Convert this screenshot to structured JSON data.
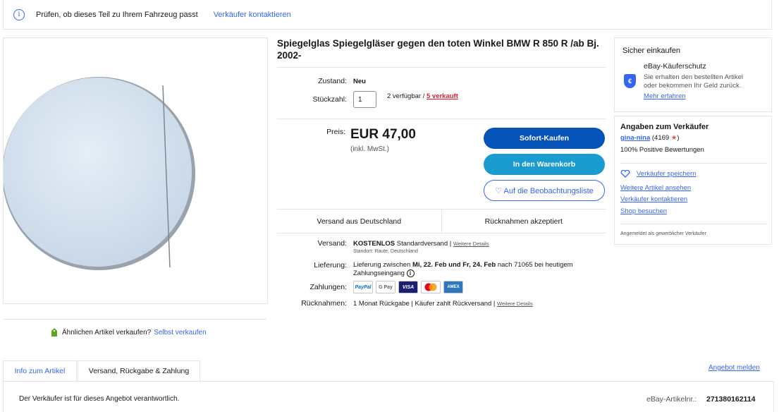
{
  "banner": {
    "text": "Prüfen, ob dieses Teil zu Ihrem Fahrzeug passt",
    "link": "Verkäufer kontaktieren"
  },
  "product": {
    "title": "Spiegelglas Spiegelgläser gegen den toten Winkel BMW R 850 R /ab Bj. 2002-",
    "condition_label": "Zustand:",
    "condition_value": "Neu",
    "quantity_label": "Stückzahl:",
    "quantity_value": "1",
    "available": "2 verfügbar /",
    "sold": "5 verkauft",
    "price_label": "Preis:",
    "price": "EUR 47,00",
    "price_sub": "(inkl. MwSt.)"
  },
  "actions": {
    "buy_now": "Sofort-Kaufen",
    "add_to_cart": "In den Warenkorb",
    "watchlist": "♡ Auf die Beobachtungsliste"
  },
  "strip": {
    "shipping_from": "Versand aus Deutschland",
    "returns": "Rücknahmen akzeptiert"
  },
  "details": {
    "shipping_label": "Versand:",
    "shipping_free": "KOSTENLOS",
    "shipping_type": "Standardversand |",
    "shipping_more": "Weitere Details",
    "location": "Standort: Raute, Deutschland",
    "delivery_label": "Lieferung:",
    "delivery_pre": "Lieferung zwischen",
    "delivery_dates": "Mi, 22. Feb und Fr, 24. Feb",
    "delivery_post": "nach 71065 bei heutigem",
    "delivery_line2": "Zahlungseingang",
    "payments_label": "Zahlungen:",
    "payments": [
      "PayPal",
      "G Pay",
      "VISA",
      "",
      "AMEX"
    ],
    "returns_label": "Rücknahmen:",
    "returns_text": "1 Monat Rückgabe | Käufer zahlt Rückversand |",
    "returns_more": "Weitere Details"
  },
  "safe_buy": {
    "heading": "Sicher einkaufen",
    "title": "eBay-Käuferschutz",
    "line1": "Sie erhalten den bestellten Artikel",
    "line2": "oder bekommen Ihr Geld zurück.",
    "link": "Mehr erfahren"
  },
  "seller": {
    "heading": "Angaben zum Verkäufer",
    "name": "gina-nina",
    "score": "(4169",
    "score_close": ")",
    "positive": "100% Positive Bewertungen",
    "save": "Verkäufer speichern",
    "more_items": "Weitere Artikel ansehen",
    "contact": "Verkäufer kontaktieren",
    "shop": "Shop besuchen",
    "registered": "Angemeldet als gewerblicher Verkäufer"
  },
  "sell_similar": {
    "text": "Ähnlichen Artikel verkaufen?",
    "link": "Selbst verkaufen"
  },
  "tabs": {
    "tab1": "Info zum Artikel",
    "tab2": "Versand, Rückgabe & Zahlung",
    "report": "Angebot melden"
  },
  "panel": {
    "responsible": "Der Verkäufer ist für dieses Angebot verantwortlich.",
    "item_number_label": "eBay-Artikelnr.:",
    "item_number": "271380162114"
  },
  "colors": {
    "link": "#3665f3",
    "buy": "#0654ba",
    "cart": "#1a9cd0",
    "sold": "#dd1e31"
  }
}
